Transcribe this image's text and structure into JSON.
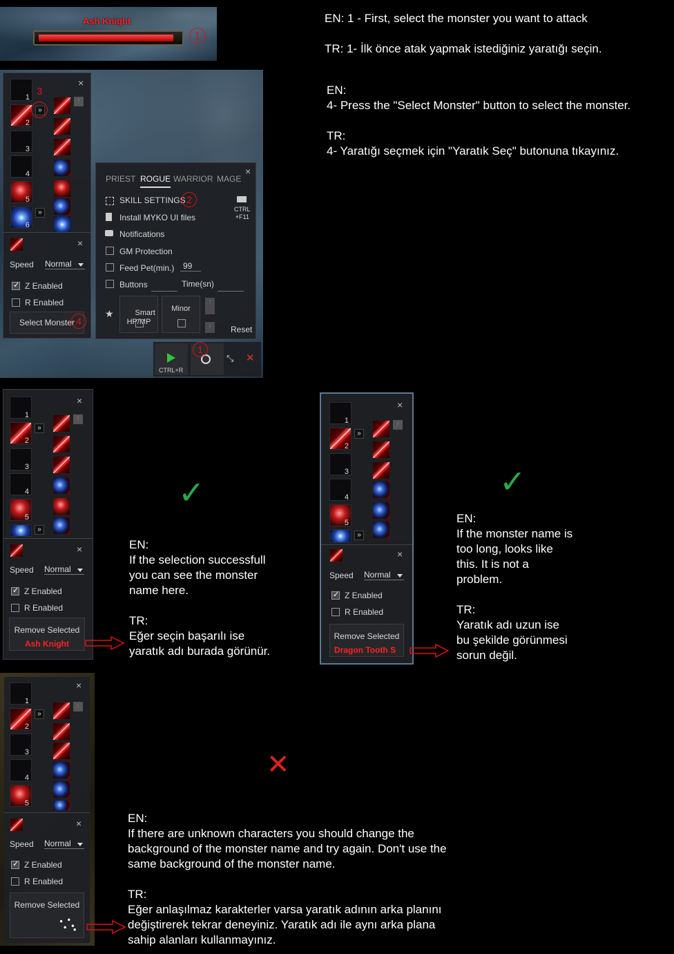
{
  "target_bar": {
    "name": "Ash Knight",
    "step": "1"
  },
  "instructions": {
    "step1": "EN: 1 - First, select the monster you want to attack\n\nTR: 1- İlk önce atak yapmak istediğiniz yaratığı seçin.",
    "step4": "EN:\n4- Press the \"Select Monster\" button to select the monster.\n\nTR:\n4- Yaratığı seçmek için \"Yaratık Seç\" butonuna tıkayınız.",
    "success": "EN:\nIf the selection successfull\nyou can see the monster\nname here.\n\nTR:\nEğer seçin başarılı ise\nyaratık adı burada görünür.",
    "long_name": "EN:\nIf the monster name is\ntoo long, looks like\nthis. It is not a\nproblem.\n\nTR:\nYaratık adı uzun ise\nbu şekilde görünmesi\nsorun değil.",
    "unknown": "EN:\nIf there are unknown characters you should change the\nbackground of the monster name and try again. Don't use the\nsame background of the monster name.\n\nTR:\nEğer anlaşılmaz karakterler varsa yaratık adının arka planını\ndeğiştirerek tekrar deneyiniz. Yaratık adı ile aynı arka plana\nsahip alanları kullanmayınız."
  },
  "settings": {
    "tabs": [
      "PRIEST",
      "ROGUE",
      "WARRIOR",
      "MAGE"
    ],
    "active_tab": "ROGUE",
    "skill_settings": "SKILL SETTINGS",
    "install": "Install MYKO UI files",
    "notifications": "Notifications",
    "gm_protection": "GM Protection",
    "feed_pet": "Feed Pet(min.)",
    "feed_pet_value": "99",
    "buttons": "Buttons",
    "time": "Time(sn)",
    "smart": "Smart\nHP/MP",
    "minor": "Minor",
    "reset": "Reset",
    "ctrl_f11": "CTRL\n+F11",
    "step2": "2"
  },
  "skill_panel": {
    "slots": [
      "1",
      "2",
      "3",
      "4",
      "5",
      "6"
    ],
    "speed_label": "Speed",
    "speed_value": "Normal",
    "z_enabled": "Z Enabled",
    "r_enabled": "R Enabled",
    "select_monster": "Select Monster",
    "remove_selected": "Remove Selected",
    "step3": "3",
    "step4": "4"
  },
  "bottom_bar": {
    "ctrl_r": "CTRL+R",
    "step1": "1"
  },
  "examples": {
    "success_name": "Ash Knight",
    "long_name": "Dragon Tooth S",
    "check_glyph": "✓",
    "cross_glyph": "✕"
  },
  "colors": {
    "accent_red": "#e01010",
    "check_green": "#29a84a",
    "name_red": "#ff2020"
  }
}
